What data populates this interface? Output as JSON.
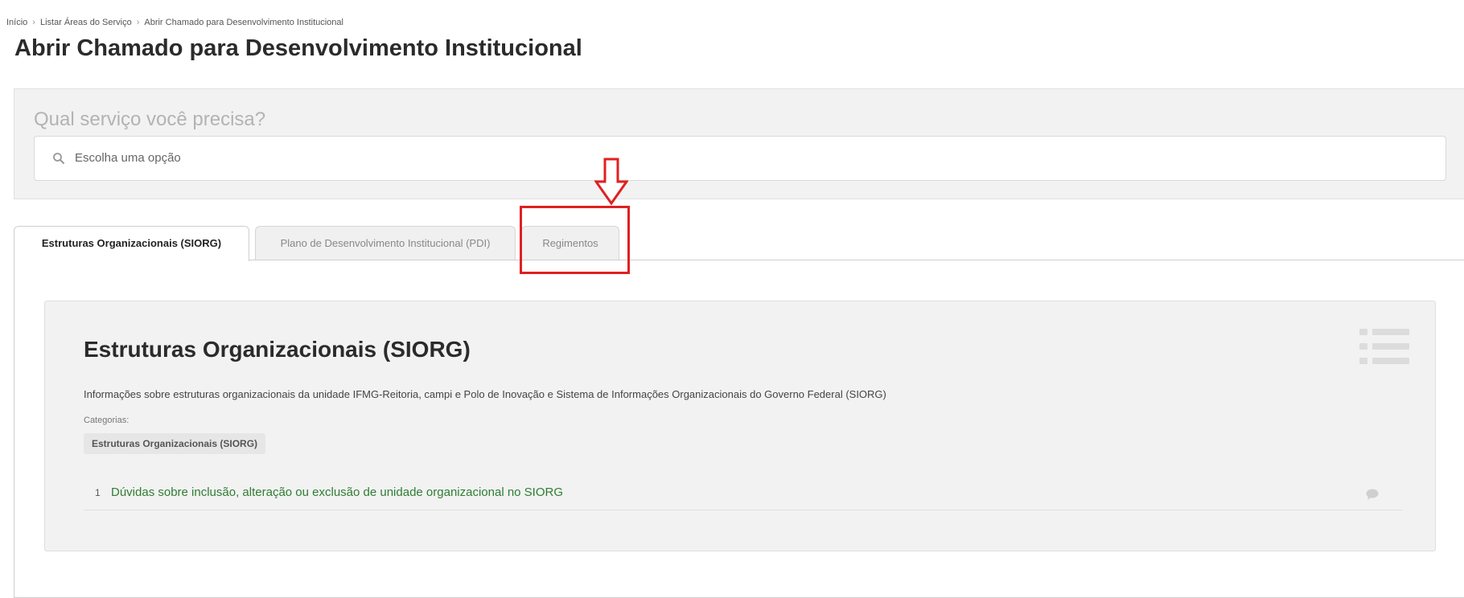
{
  "breadcrumb": {
    "items": [
      "Início",
      "Listar Áreas do Serviço",
      "Abrir Chamado para Desenvolvimento Institucional"
    ],
    "separator": "›"
  },
  "page_title": "Abrir Chamado para Desenvolvimento Institucional",
  "search": {
    "question": "Qual serviço você precisa?",
    "placeholder": "Escolha uma opção",
    "icon": "search-icon"
  },
  "tabs": [
    {
      "label": "Estruturas Organizacionais (SIORG)",
      "active": true
    },
    {
      "label": "Plano de Desenvolvimento Institucional (PDI)",
      "active": false
    },
    {
      "label": "Regimentos",
      "active": false
    }
  ],
  "card": {
    "title": "Estruturas Organizacionais (SIORG)",
    "description": "Informações sobre estruturas organizacionais da unidade IFMG-Reitoria, campi e Polo de Inovação e Sistema de Informações Organizacionais do Governo Federal (SIORG)",
    "categories_label": "Categorias:",
    "category_chip": "Estruturas Organizacionais (SIORG)",
    "icon": "list-icon",
    "services": [
      {
        "number": "1",
        "label": "Dúvidas sobre inclusão, alteração ou exclusão de unidade organizacional no SIORG",
        "icon": "comment-icon"
      }
    ]
  },
  "colors": {
    "link_green": "#2f7d32",
    "annotation_red": "#e02020",
    "panel_gray": "#f2f2f2"
  }
}
